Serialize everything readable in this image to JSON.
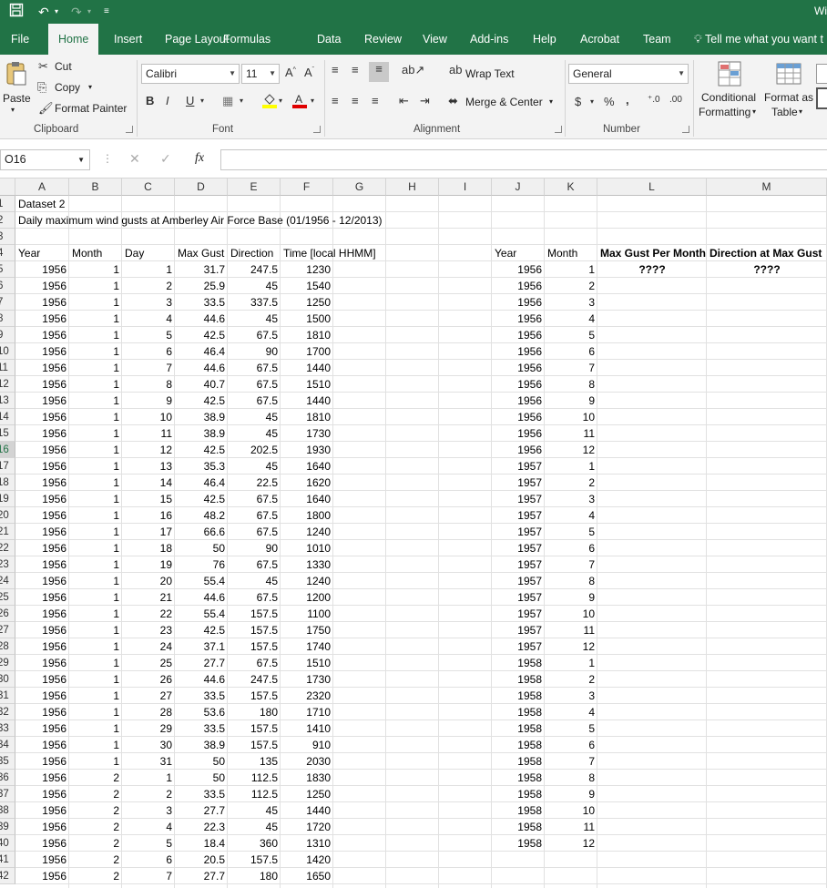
{
  "titlebar": {
    "title": "Wi",
    "save_icon": "save-icon",
    "undo_icon": "undo-icon",
    "redo_icon": "redo-icon"
  },
  "tabs": [
    "File",
    "Home",
    "Insert",
    "Page Layout",
    "Formulas",
    "Data",
    "Review",
    "View",
    "Add-ins",
    "Help",
    "Acrobat",
    "Team"
  ],
  "active_tab": "Home",
  "tell_me": "Tell me what you want t",
  "ribbon": {
    "clipboard": {
      "paste": "Paste",
      "cut": "Cut",
      "copy": "Copy",
      "format_painter": "Format Painter",
      "label": "Clipboard"
    },
    "font": {
      "name": "Calibri",
      "size": "11",
      "label": "Font",
      "bold": "B",
      "italic": "I",
      "underline": "U"
    },
    "alignment": {
      "wrap": "Wrap Text",
      "merge": "Merge & Center",
      "label": "Alignment"
    },
    "number": {
      "format": "General",
      "currency": "$",
      "percent": "%",
      "comma": ",",
      "label": "Number"
    },
    "styles": {
      "conditional": "Conditional",
      "conditional2": "Formatting",
      "format_as": "Format as",
      "format_as2": "Table"
    }
  },
  "formula_bar": {
    "name_box": "O16",
    "fx": "fx",
    "formula": ""
  },
  "columns": [
    "A",
    "B",
    "C",
    "D",
    "E",
    "F",
    "G",
    "H",
    "I",
    "J",
    "K",
    "L",
    "M"
  ],
  "selected_row": 16,
  "sheet": {
    "a1": "Dataset 2",
    "a2": "Daily maximum wind gusts at Amberley Air Force Base (01/1956 - 12/2013)",
    "headers_left": [
      "Year",
      "Month",
      "Day",
      "Max Gust",
      "Direction",
      "Time [local HHMM]"
    ],
    "headers_right": [
      "Year",
      "Month",
      "Max Gust Per Month",
      "Direction at Max Gust"
    ],
    "placeholder_l": "????",
    "placeholder_m": "????",
    "rows_left": [
      [
        1956,
        1,
        1,
        31.7,
        247.5,
        1230
      ],
      [
        1956,
        1,
        2,
        25.9,
        45,
        1540
      ],
      [
        1956,
        1,
        3,
        33.5,
        337.5,
        1250
      ],
      [
        1956,
        1,
        4,
        44.6,
        45,
        1500
      ],
      [
        1956,
        1,
        5,
        42.5,
        67.5,
        1810
      ],
      [
        1956,
        1,
        6,
        46.4,
        90,
        1700
      ],
      [
        1956,
        1,
        7,
        44.6,
        67.5,
        1440
      ],
      [
        1956,
        1,
        8,
        40.7,
        67.5,
        1510
      ],
      [
        1956,
        1,
        9,
        42.5,
        67.5,
        1440
      ],
      [
        1956,
        1,
        10,
        38.9,
        45,
        1810
      ],
      [
        1956,
        1,
        11,
        38.9,
        45,
        1730
      ],
      [
        1956,
        1,
        12,
        42.5,
        202.5,
        1930
      ],
      [
        1956,
        1,
        13,
        35.3,
        45,
        1640
      ],
      [
        1956,
        1,
        14,
        46.4,
        22.5,
        1620
      ],
      [
        1956,
        1,
        15,
        42.5,
        67.5,
        1640
      ],
      [
        1956,
        1,
        16,
        48.2,
        67.5,
        1800
      ],
      [
        1956,
        1,
        17,
        66.6,
        67.5,
        1240
      ],
      [
        1956,
        1,
        18,
        50,
        90,
        1010
      ],
      [
        1956,
        1,
        19,
        76,
        67.5,
        1330
      ],
      [
        1956,
        1,
        20,
        55.4,
        45,
        1240
      ],
      [
        1956,
        1,
        21,
        44.6,
        67.5,
        1200
      ],
      [
        1956,
        1,
        22,
        55.4,
        157.5,
        1100
      ],
      [
        1956,
        1,
        23,
        42.5,
        157.5,
        1750
      ],
      [
        1956,
        1,
        24,
        37.1,
        157.5,
        1740
      ],
      [
        1956,
        1,
        25,
        27.7,
        67.5,
        1510
      ],
      [
        1956,
        1,
        26,
        44.6,
        247.5,
        1730
      ],
      [
        1956,
        1,
        27,
        33.5,
        157.5,
        2320
      ],
      [
        1956,
        1,
        28,
        53.6,
        180,
        1710
      ],
      [
        1956,
        1,
        29,
        33.5,
        157.5,
        1410
      ],
      [
        1956,
        1,
        30,
        38.9,
        157.5,
        910
      ],
      [
        1956,
        1,
        31,
        50,
        135,
        2030
      ],
      [
        1956,
        2,
        1,
        50,
        112.5,
        1830
      ],
      [
        1956,
        2,
        2,
        33.5,
        112.5,
        1250
      ],
      [
        1956,
        2,
        3,
        27.7,
        45,
        1440
      ],
      [
        1956,
        2,
        4,
        22.3,
        45,
        1720
      ],
      [
        1956,
        2,
        5,
        18.4,
        360,
        1310
      ],
      [
        1956,
        2,
        6,
        20.5,
        157.5,
        1420
      ],
      [
        1956,
        2,
        7,
        27.7,
        180,
        1650
      ]
    ],
    "rows_right": [
      [
        1956,
        1
      ],
      [
        1956,
        2
      ],
      [
        1956,
        3
      ],
      [
        1956,
        4
      ],
      [
        1956,
        5
      ],
      [
        1956,
        6
      ],
      [
        1956,
        7
      ],
      [
        1956,
        8
      ],
      [
        1956,
        9
      ],
      [
        1956,
        10
      ],
      [
        1956,
        11
      ],
      [
        1956,
        12
      ],
      [
        1957,
        1
      ],
      [
        1957,
        2
      ],
      [
        1957,
        3
      ],
      [
        1957,
        4
      ],
      [
        1957,
        5
      ],
      [
        1957,
        6
      ],
      [
        1957,
        7
      ],
      [
        1957,
        8
      ],
      [
        1957,
        9
      ],
      [
        1957,
        10
      ],
      [
        1957,
        11
      ],
      [
        1957,
        12
      ],
      [
        1958,
        1
      ],
      [
        1958,
        2
      ],
      [
        1958,
        3
      ],
      [
        1958,
        4
      ],
      [
        1958,
        5
      ],
      [
        1958,
        6
      ],
      [
        1958,
        7
      ],
      [
        1958,
        8
      ],
      [
        1958,
        9
      ],
      [
        1958,
        10
      ],
      [
        1958,
        11
      ],
      [
        1958,
        12
      ]
    ]
  }
}
